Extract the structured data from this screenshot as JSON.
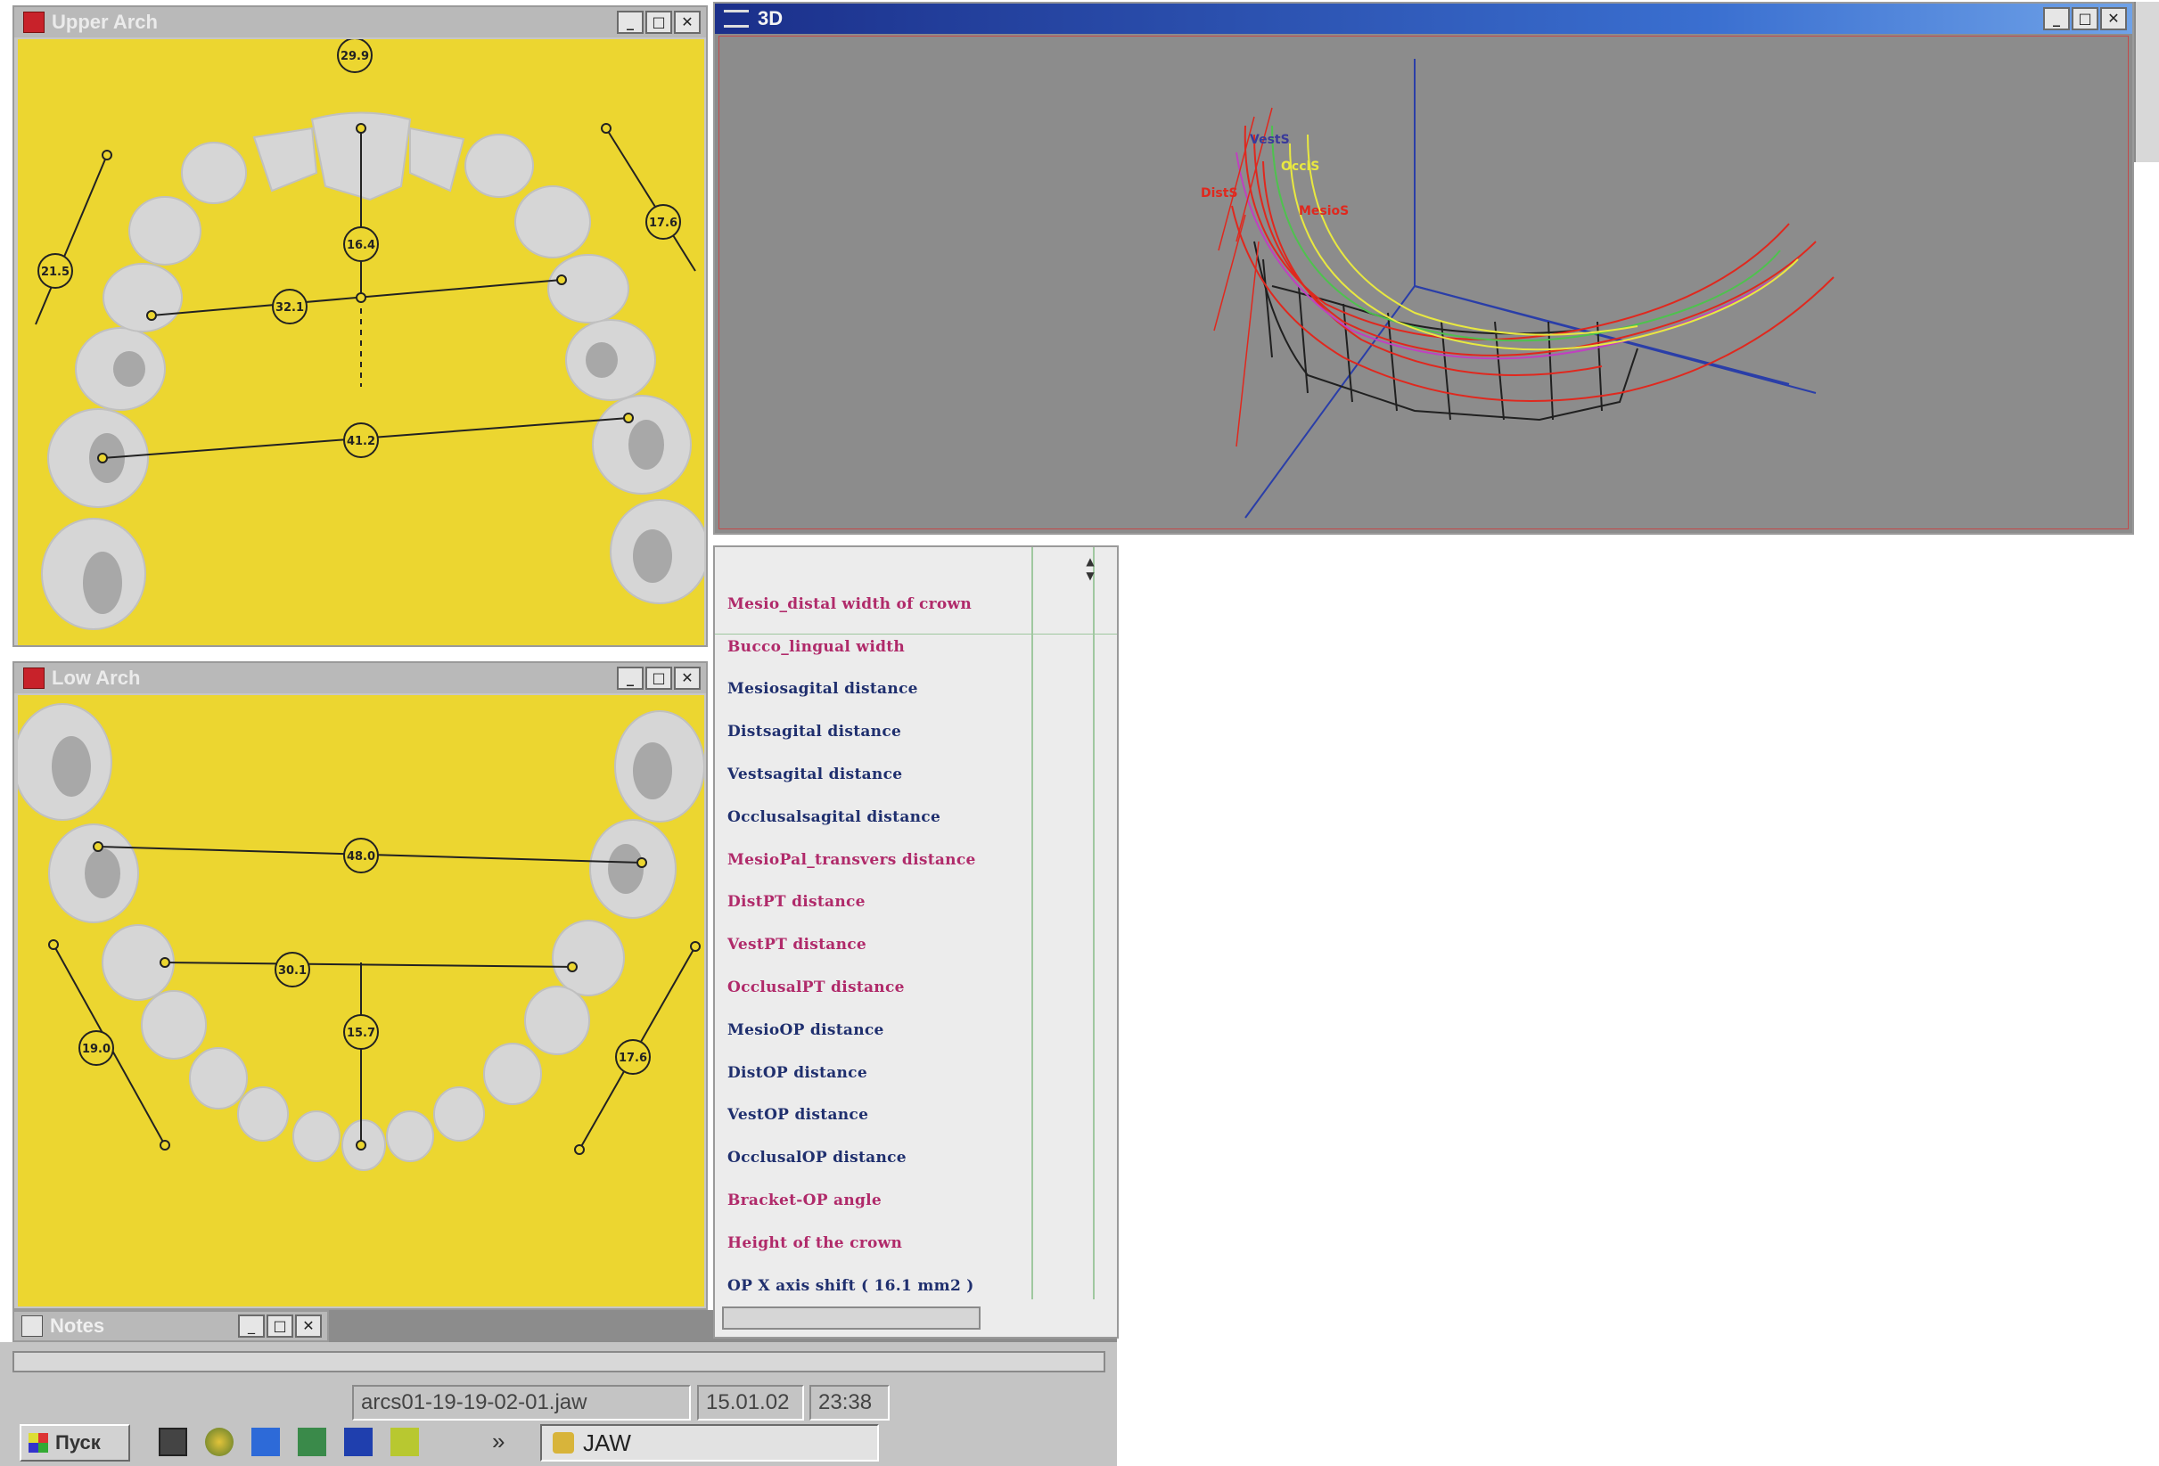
{
  "upper_arch": {
    "title": "Upper Arch",
    "measurements": [
      "29.9",
      "21.5",
      "17.6",
      "16.4",
      "32.1",
      "41.2"
    ]
  },
  "low_arch": {
    "title": "Low Arch",
    "measurements": [
      "48.0",
      "30.1",
      "15.7",
      "19.0",
      "17.6"
    ]
  },
  "window_3d": {
    "title": "3D",
    "labels": [
      "VestS",
      "DistS",
      "OcclS",
      "MesioS"
    ]
  },
  "notes": {
    "title": "Notes"
  },
  "window_buttons": {
    "minimize": "_",
    "maximize": "□",
    "close": "✕"
  },
  "parameter_list": {
    "items": [
      {
        "label": "Mesio_distal width of crown",
        "color": "#b02a6a"
      },
      {
        "label": "Bucco_lingual width",
        "color": "#b02a6a"
      },
      {
        "label": "Mesiosagital distance",
        "color": "#1f2f6e"
      },
      {
        "label": "Distsagital distance",
        "color": "#1f2f6e"
      },
      {
        "label": "Vestsagital distance",
        "color": "#1f2f6e"
      },
      {
        "label": "Occlusalsagital distance",
        "color": "#1f2f6e"
      },
      {
        "label": "MesioPal_transvers distance",
        "color": "#b02a6a"
      },
      {
        "label": "DistPT distance",
        "color": "#b02a6a"
      },
      {
        "label": "VestPT distance",
        "color": "#b02a6a"
      },
      {
        "label": "OcclusalPT distance",
        "color": "#b02a6a"
      },
      {
        "label": "MesioOP distance",
        "color": "#1f2f6e"
      },
      {
        "label": "DistOP distance",
        "color": "#1f2f6e"
      },
      {
        "label": "VestOP distance",
        "color": "#1f2f6e"
      },
      {
        "label": "OcclusalOP distance",
        "color": "#1f2f6e"
      },
      {
        "label": "Bracket-OP angle",
        "color": "#b02a6a"
      },
      {
        "label": "Height of the crown",
        "color": "#b02a6a"
      },
      {
        "label": "OP X axis shift ( 16.1 mm2 )",
        "color": "#1f2f6e"
      }
    ]
  },
  "statusbar": {
    "filename": "arcs01-19-19-02-01.jaw",
    "date": "15.01.02",
    "time": "23:38"
  },
  "taskbar": {
    "start_label": "Пуск",
    "task_label": "JAW",
    "more": "»"
  },
  "colors": {
    "arch_bg": "#ecd630",
    "viewport_bg": "#8c8c8c",
    "tooth": "#d6d6d6",
    "tooth_shadow": "#a8a8a8"
  }
}
